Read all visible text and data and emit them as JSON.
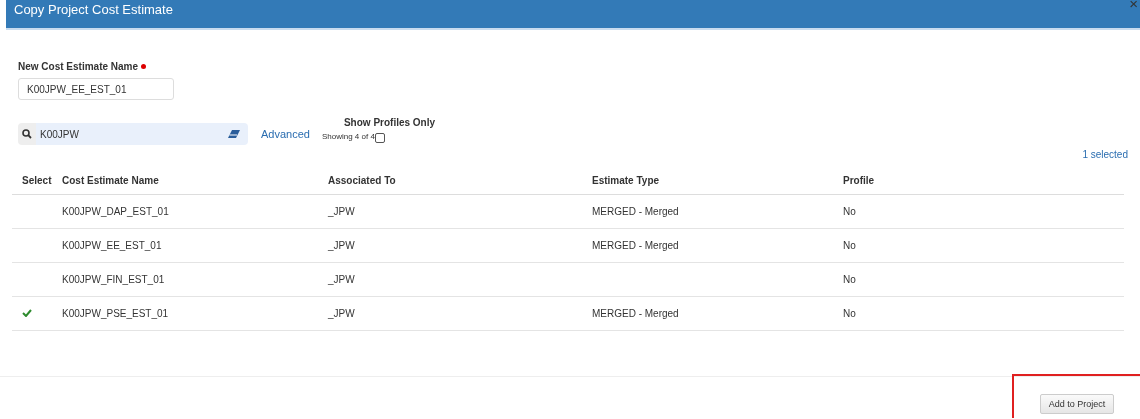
{
  "window": {
    "title": "Copy Project Cost Estimate",
    "close": "×"
  },
  "name_field": {
    "label": "New Cost Estimate Name",
    "required": true,
    "value": "K00JPW_EE_EST_01"
  },
  "search": {
    "value": "K00JPW",
    "advanced": "Advanced",
    "showing": "Showing 4 of 4",
    "profiles_only": {
      "label": "Show Profiles Only",
      "checked": false
    }
  },
  "selected_count": "1 selected",
  "table": {
    "columns": [
      "Select",
      "Cost Estimate Name",
      "Associated To",
      "Estimate Type",
      "Profile"
    ],
    "rows": [
      {
        "selected": false,
        "name": "K00JPW_DAP_EST_01",
        "associated": "_JPW",
        "type": "MERGED - Merged",
        "profile": "No"
      },
      {
        "selected": false,
        "name": "K00JPW_EE_EST_01",
        "associated": "_JPW",
        "type": "MERGED - Merged",
        "profile": "No"
      },
      {
        "selected": false,
        "name": "K00JPW_FIN_EST_01",
        "associated": "_JPW",
        "profile": "No"
      },
      {
        "selected": true,
        "name": "K00JPW_PSE_EST_01",
        "associated": "_JPW",
        "type": "MERGED - Merged",
        "profile": "No"
      }
    ]
  },
  "footer": {
    "button": "Add to Project",
    "highlighted": true
  }
}
